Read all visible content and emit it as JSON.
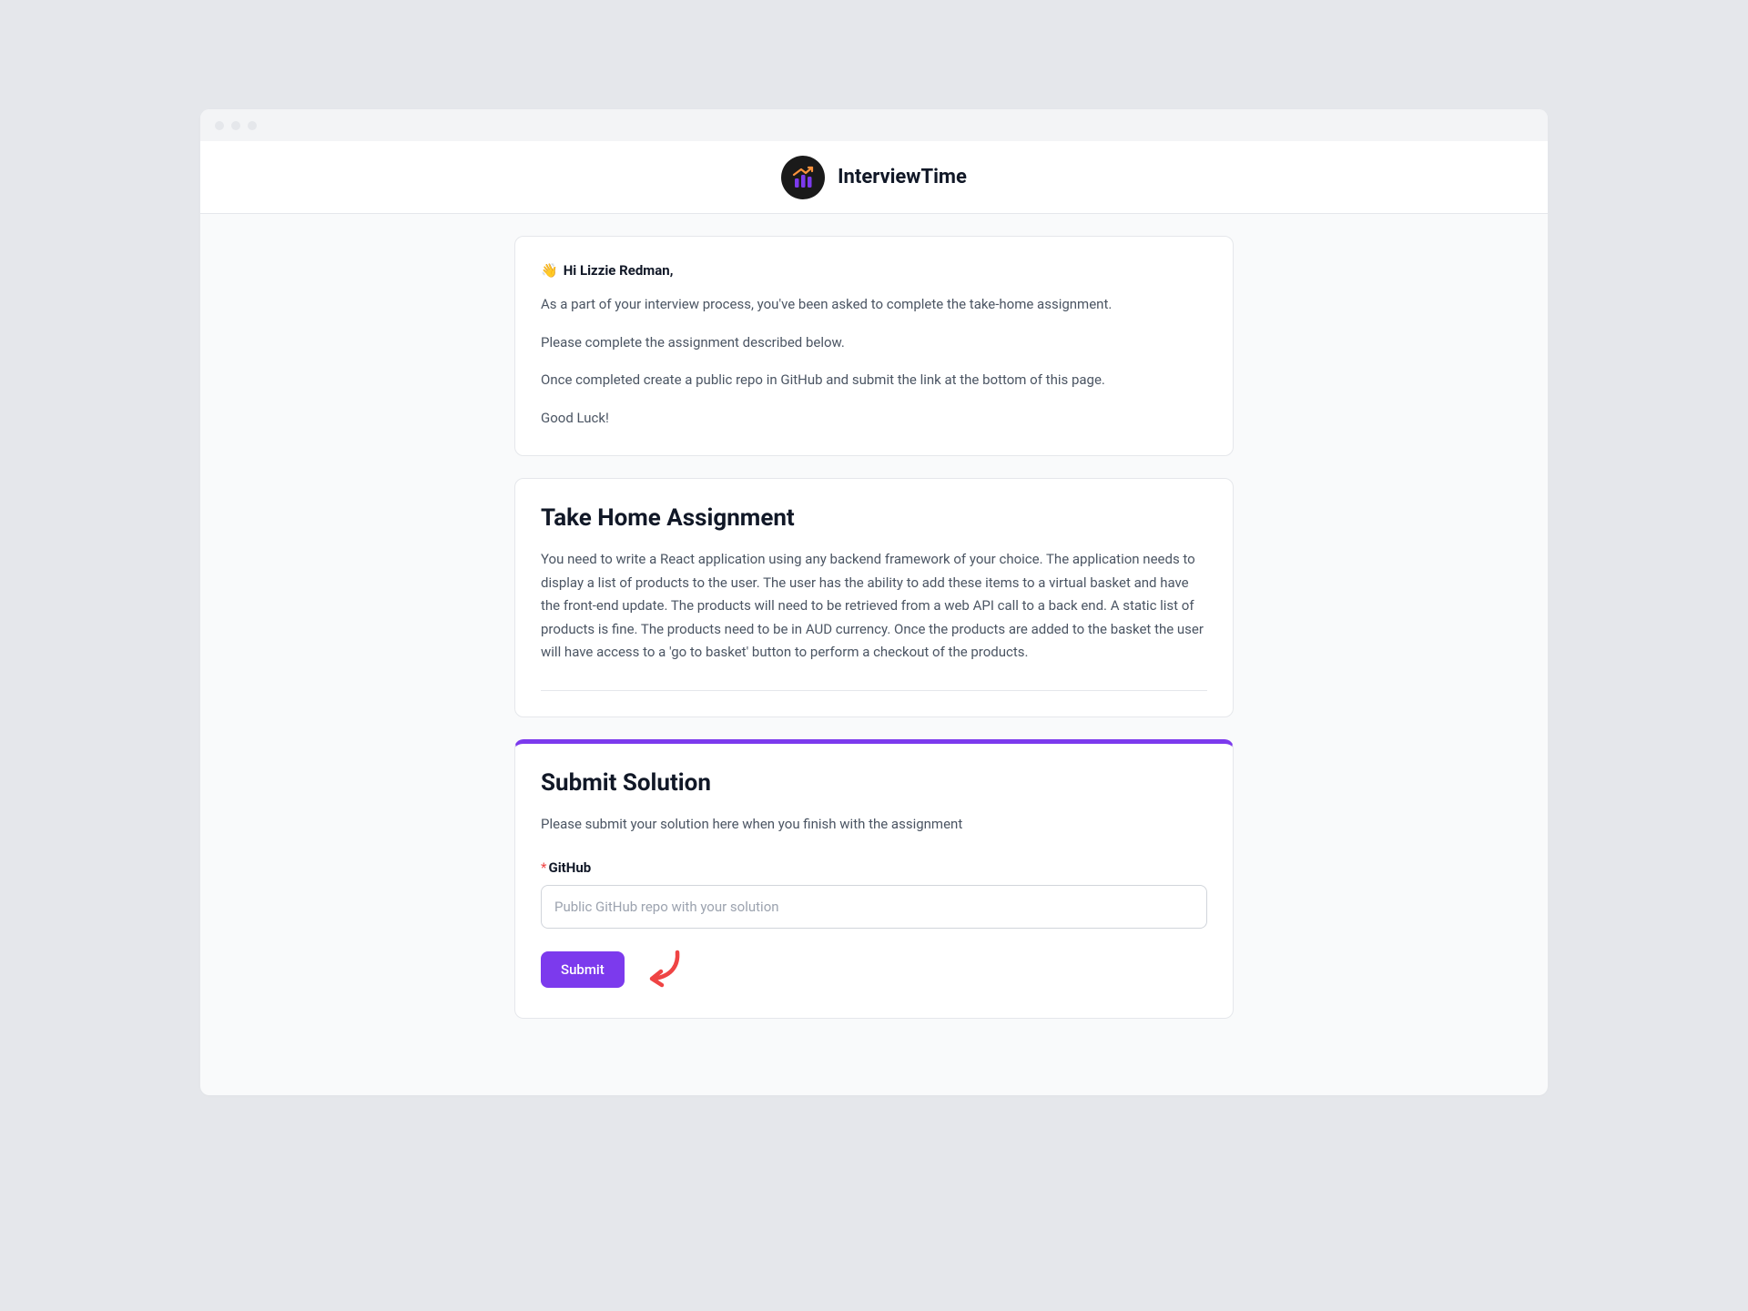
{
  "header": {
    "brand_name": "InterviewTime"
  },
  "intro": {
    "wave_emoji": "👋",
    "greeting": "Hi Lizzie Redman,",
    "p1": "As a part of your interview process, you've been asked to complete the take-home assignment.",
    "p2": "Please complete the assignment described below.",
    "p3": "Once completed create a public repo in GitHub and submit the link at the bottom of this page.",
    "p4": "Good Luck!"
  },
  "assignment": {
    "title": "Take Home Assignment",
    "body": "You need to write a React application using any backend framework of your choice. The application needs to display a list of products to the user. The user has the ability to add these items to a virtual basket and have the front-end update. The products will need to be retrieved from a web API call to a back end. A static list of products is fine. The products need to be in AUD currency. Once the products are added to the basket the user will have access to a 'go to basket' button to perform a checkout of the products."
  },
  "submit": {
    "title": "Submit Solution",
    "subtitle": "Please submit your solution here when you finish with the assignment",
    "field_label": "GitHub",
    "required_marker": "*",
    "placeholder": "Public GitHub repo with your solution",
    "button_label": "Submit",
    "input_value": ""
  },
  "colors": {
    "accent": "#7c3aed",
    "annotation": "#ef4444"
  }
}
